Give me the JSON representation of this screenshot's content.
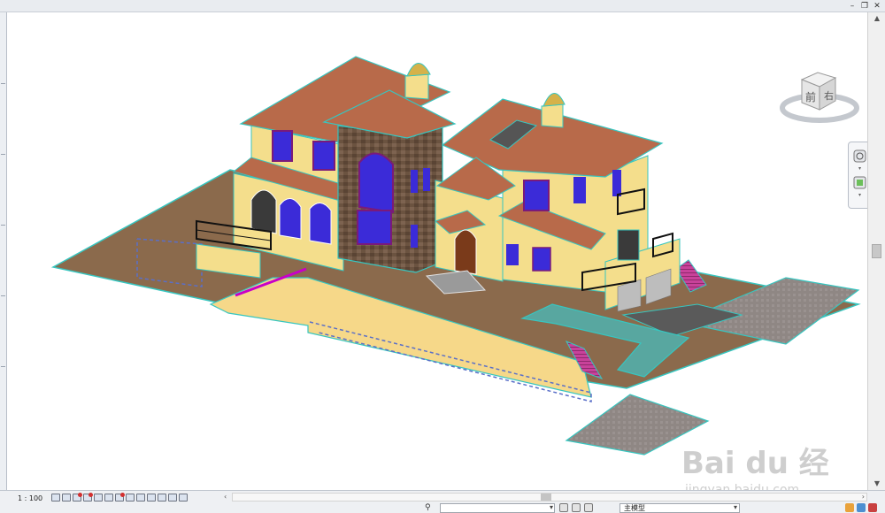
{
  "window": {
    "controls": [
      "–",
      "❐",
      "✕"
    ]
  },
  "viewcube": {
    "front_face": "前",
    "right_face": "右",
    "icon": "viewcube-icon"
  },
  "navbar": {
    "icons": [
      "steering-wheel-icon",
      "zoom-icon"
    ]
  },
  "status": {
    "scale": "1 : 100",
    "view_icons": [
      "detail-level-icon",
      "visual-style-icon",
      "sun-path-icon",
      "shadows-icon",
      "crop-region-icon",
      "show-crop-icon",
      "temporary-hide-icon",
      "reveal-hidden-icon",
      "lock-3d-icon",
      "analytical-model-icon",
      "highlight-displacement-icon",
      "design-options-icon",
      "constraints-icon"
    ],
    "selector_value": "",
    "model_name": "主模型",
    "scroll_left_arrow": "‹",
    "scroll_right_arrow": "›"
  },
  "watermark": {
    "brand": "Bai du 经验",
    "url": "jingyan.baidu.com"
  },
  "colors": {
    "roof": "#b86a4a",
    "wall": "#f4de8c",
    "stone": "#6b5340",
    "ground": "#8b6a4c",
    "path": "#8f8784",
    "edge": "#37c6c0",
    "window": "#3b2bd8",
    "stairs_pink": "#c8429a"
  }
}
